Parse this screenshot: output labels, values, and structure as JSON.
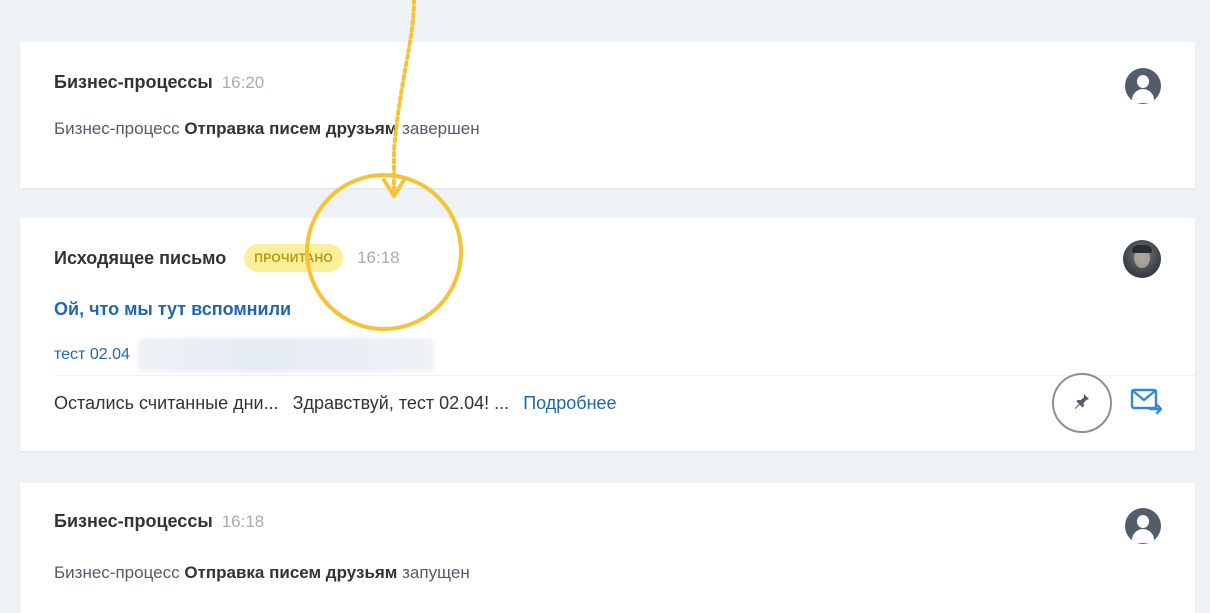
{
  "feed": {
    "items": [
      {
        "type": "business-process",
        "title": "Бизнес-процессы",
        "time": "16:20",
        "desc_prefix": "Бизнес-процесс",
        "desc_bold": "Отправка писем друзьям",
        "desc_suffix": "завершен",
        "avatar": "user-icon"
      },
      {
        "type": "outgoing-email",
        "title": "Исходящее письмо",
        "badge": "ПРОЧИТАНО",
        "time": "16:18",
        "subject": "Ой, что мы тут вспомнили",
        "recipient": "тест 02.04",
        "preview_1": "Остались считанные дни...",
        "preview_2": "Здравствуй, тест 02.04! ...",
        "more_link": "Подробнее",
        "avatar": "user-photo",
        "actions": [
          "pin-icon",
          "mail-forward-icon"
        ]
      },
      {
        "type": "business-process",
        "title": "Бизнес-процессы",
        "time": "16:18",
        "desc_prefix": "Бизнес-процесс",
        "desc_bold": "Отправка писем друзьям",
        "desc_suffix": "запущен",
        "avatar": "user-icon"
      }
    ]
  },
  "annotation": {
    "highlight_color": "#f6c338",
    "arrow_style": "dotted"
  },
  "colors": {
    "link": "#2067b0",
    "badge_bg": "#fbf09a",
    "badge_text": "#b59a17",
    "muted_time": "#a8adb4",
    "icon_dark": "#535c69"
  }
}
